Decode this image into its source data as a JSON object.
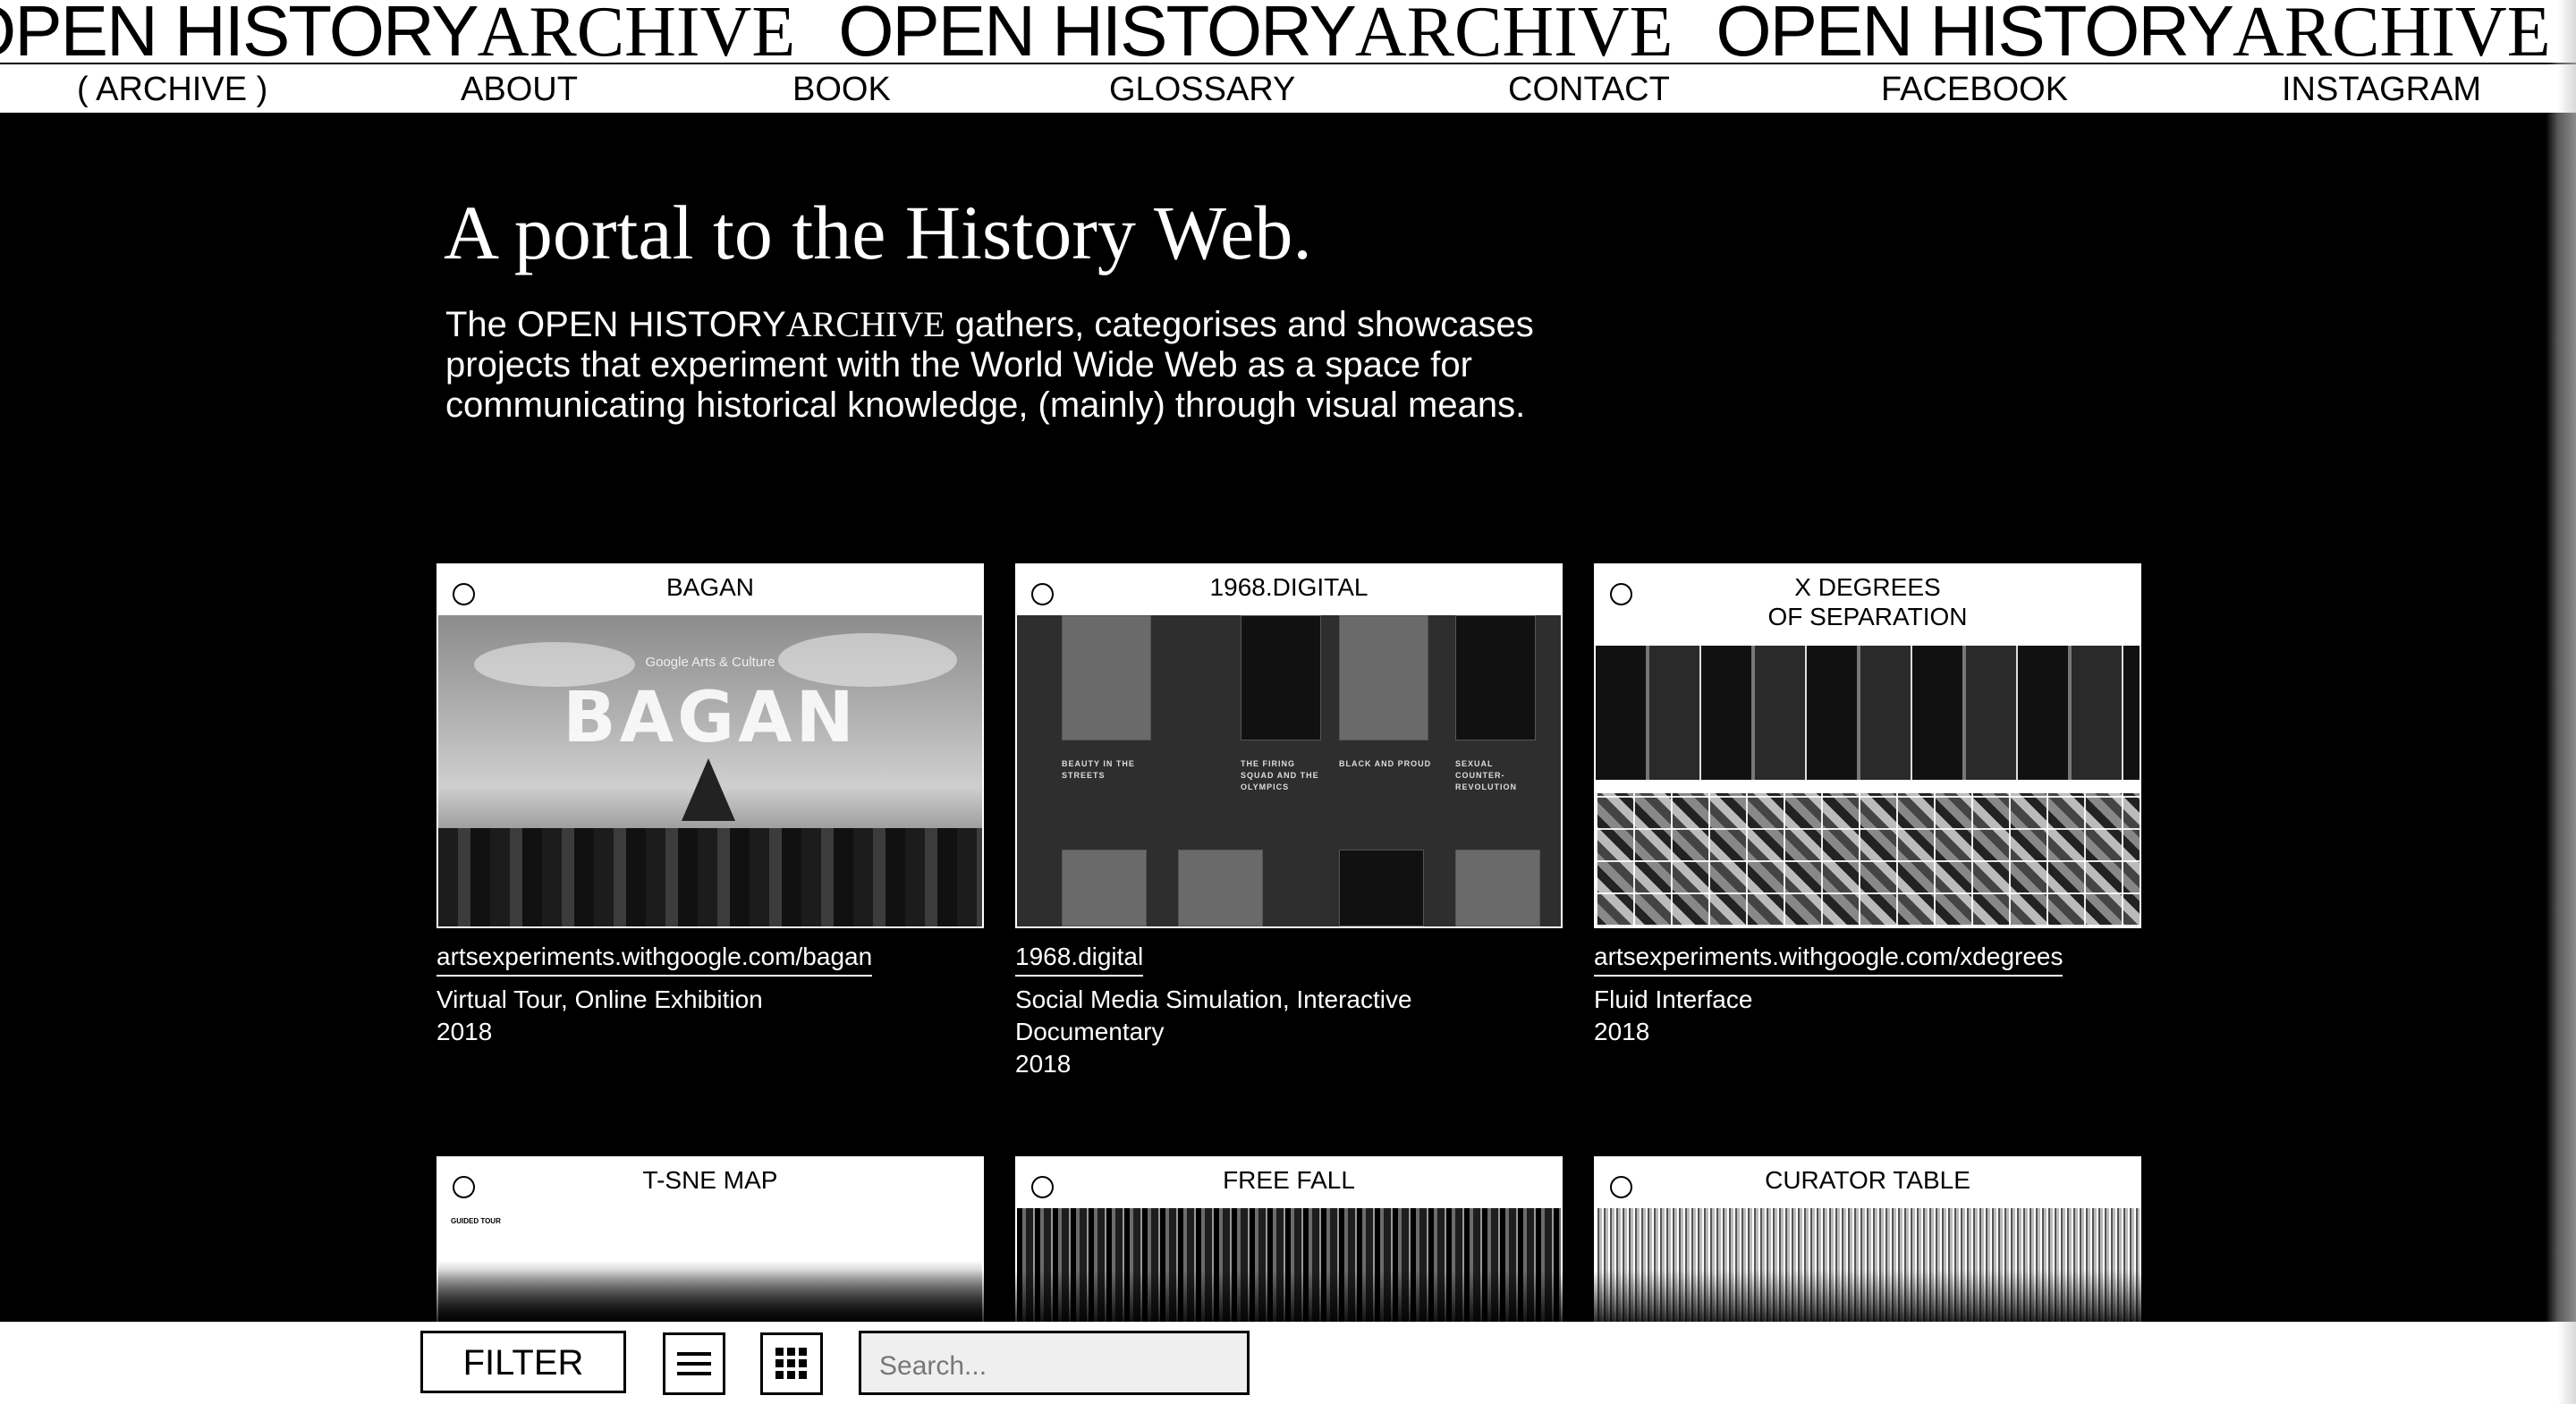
{
  "brand": {
    "marquee_sans": "OPEN HISTORY",
    "marquee_serif": "ARCHIVE"
  },
  "nav": {
    "items": [
      {
        "label": "( ARCHIVE )"
      },
      {
        "label": "ABOUT"
      },
      {
        "label": "BOOK"
      },
      {
        "label": "GLOSSARY"
      },
      {
        "label": "CONTACT"
      },
      {
        "label": "FACEBOOK"
      },
      {
        "label": "INSTAGRAM"
      }
    ]
  },
  "intro": {
    "headline": "A portal to the History Web.",
    "body_prefix": "The OPEN HISTORY",
    "body_serif": "ARCHIVE",
    "body_suffix": " gathers, categorises and showcases projects that experiment with the World Wide Web as a space for communicating historical knowledge, (mainly) through visual means."
  },
  "cards": [
    {
      "title": "BAGAN",
      "thumb_title": "BAGAN",
      "thumb_sub": "Google Arts & Culture",
      "link": "artsexperiments.withgoogle.com/bagan",
      "type": "Virtual Tour, Online Exhibition",
      "year": "2018"
    },
    {
      "title": "1968.DIGITAL",
      "thumb_labels": [
        "BEAUTY IN THE STREETS",
        "THE FIRING SQUAD AND THE OLYMPICS",
        "BLACK AND PROUD",
        "SEXUAL COUNTER-REVOLUTION"
      ],
      "link": "1968.digital",
      "type": "Social Media Simulation, Interactive Documentary",
      "year": "2018"
    },
    {
      "title": "X DEGREES\nOF SEPARATION",
      "link": "artsexperiments.withgoogle.com/xdegrees",
      "type": "Fluid Interface",
      "year": "2018"
    },
    {
      "title": "T-SNE MAP",
      "thumb_label": "GUIDED TOUR"
    },
    {
      "title": "FREE FALL"
    },
    {
      "title": "CURATOR TABLE"
    }
  ],
  "toolbar": {
    "filter_label": "FILTER",
    "search_placeholder": "Search...",
    "list_view_icon": "list-icon",
    "grid_view_icon": "grid-icon"
  }
}
